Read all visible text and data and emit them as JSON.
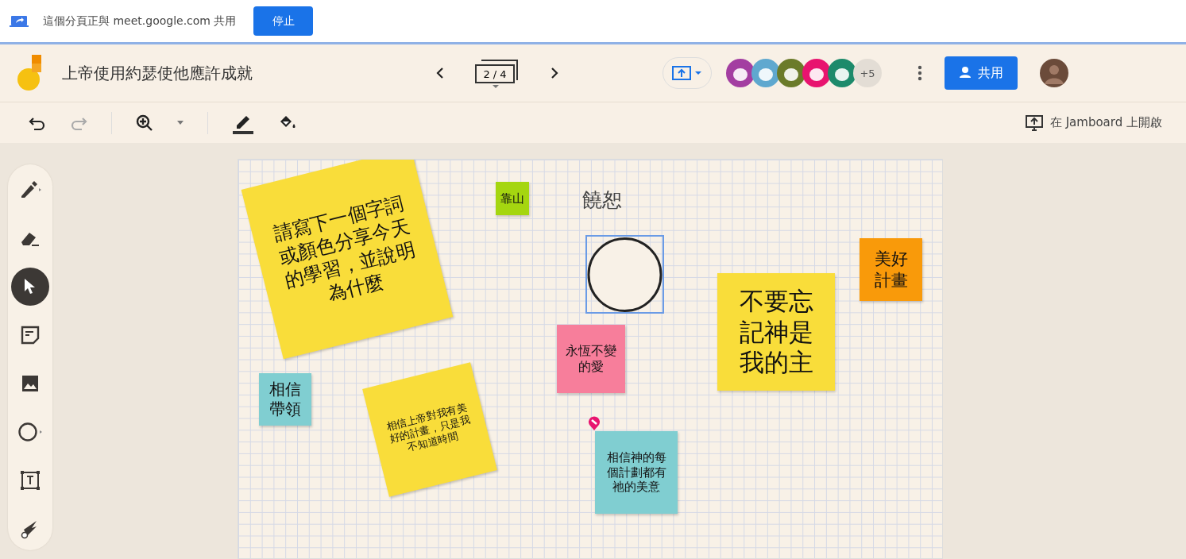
{
  "share_bar": {
    "message": "這個分頁正與 meet.google.com 共用",
    "stop_button": "停止"
  },
  "header": {
    "title": "上帝使用約瑟使他應許成就",
    "frame_counter": "2 / 4",
    "more_participants": "+5",
    "share_button": "共用"
  },
  "participants": [
    {
      "color": "#a33ea1"
    },
    {
      "color": "#5fa8cf"
    },
    {
      "color": "#6b7b2a"
    },
    {
      "color": "#e8146f"
    },
    {
      "color": "#1d8a6b"
    }
  ],
  "toolbar": {
    "open_in_jamboard": "在 Jamboard 上開啟"
  },
  "tools": [
    {
      "kind": "pen",
      "selected": false
    },
    {
      "kind": "eraser",
      "selected": false
    },
    {
      "kind": "select",
      "selected": true
    },
    {
      "kind": "note",
      "selected": false
    },
    {
      "kind": "image",
      "selected": false
    },
    {
      "kind": "circle",
      "selected": false
    },
    {
      "kind": "textbox",
      "selected": false
    },
    {
      "kind": "laser",
      "selected": false
    }
  ],
  "canvas": {
    "text_label": "饒恕",
    "circle_selected": true,
    "notes": [
      {
        "text": "請寫下一個字詞或顏色分享今天的學習，並說明為什麼",
        "color": "#f9dd3a"
      },
      {
        "text": "靠山",
        "color": "#a5d610"
      },
      {
        "text": "永恆不變的愛",
        "color": "#f77e9b"
      },
      {
        "text": "不要忘記神是我的主",
        "color": "#f9dd3a"
      },
      {
        "text": "美好計畫",
        "color": "#f99a0a"
      },
      {
        "text": "相信帶領",
        "color": "#80ced1"
      },
      {
        "text": "相信上帝對我有美好的計畫，只是我不知道時間",
        "color": "#f9dd3a"
      },
      {
        "text": "相信神的每個計劃都有祂的美意",
        "color": "#80ced1"
      }
    ]
  }
}
